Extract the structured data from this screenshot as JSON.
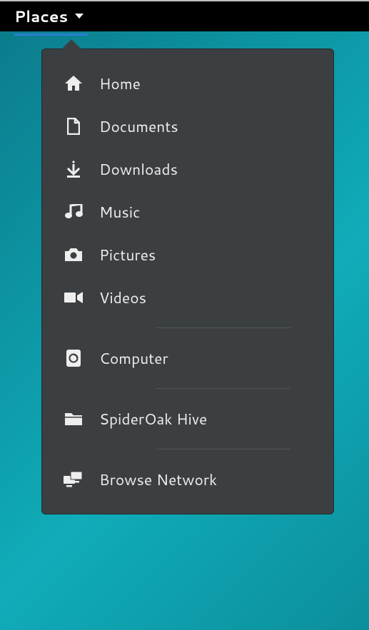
{
  "topbar": {
    "places_label": "Places"
  },
  "menu": {
    "sections": [
      [
        {
          "icon": "home",
          "label": "Home"
        },
        {
          "icon": "document",
          "label": "Documents"
        },
        {
          "icon": "download",
          "label": "Downloads"
        },
        {
          "icon": "music",
          "label": "Music"
        },
        {
          "icon": "camera",
          "label": "Pictures"
        },
        {
          "icon": "video",
          "label": "Videos"
        }
      ],
      [
        {
          "icon": "computer",
          "label": "Computer"
        }
      ],
      [
        {
          "icon": "folder",
          "label": "SpiderOak Hive"
        }
      ],
      [
        {
          "icon": "network",
          "label": "Browse Network"
        }
      ]
    ]
  }
}
